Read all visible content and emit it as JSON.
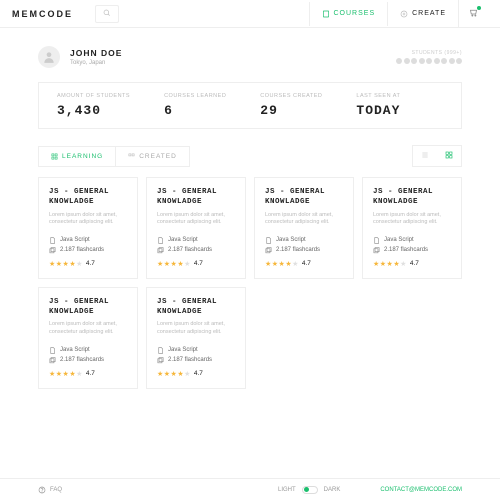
{
  "brand": "MEMCODE",
  "nav": {
    "courses": "COURSES",
    "create": "CREATE"
  },
  "user": {
    "name": "JOHN DOE",
    "location": "Tokyo, Japan"
  },
  "streak": {
    "label": "STUDENTS (999+)"
  },
  "stats": [
    {
      "label": "AMOUNT OF STUDENTS",
      "value": "3,430"
    },
    {
      "label": "COURSES LEARNED",
      "value": "6"
    },
    {
      "label": "COURSES CREATED",
      "value": "29"
    },
    {
      "label": "LAST SEEN AT",
      "value": "TODAY"
    }
  ],
  "tabs": {
    "learning": "LEARNING",
    "created": "CREATED"
  },
  "card": {
    "title": "JS - GENERAL KNOWLADGE",
    "desc": "Lorem ipsum dolor sit amet, consectetur adipiscing elit.",
    "lang": "Java Script",
    "flash": "2.187 flashcards",
    "rating": "4.7"
  },
  "footer": {
    "faq": "FAQ",
    "light": "LIGHT",
    "dark": "DARK",
    "contact": "CONTACT@MEMCODE.COM"
  }
}
